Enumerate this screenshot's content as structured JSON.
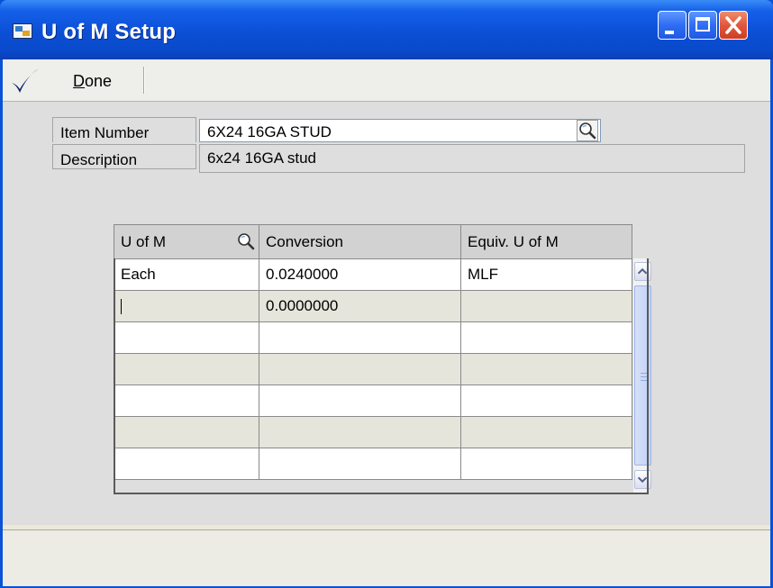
{
  "window": {
    "title": "U of M Setup",
    "icon": "app-window-icon",
    "controls": [
      "minimize-icon",
      "maximize-icon",
      "close-icon"
    ]
  },
  "toolbar": {
    "done_label_prefix": "D",
    "done_label_rest": "one",
    "done_icon": "checkmark-icon"
  },
  "form": {
    "item_number_label": "Item Number",
    "item_number_value": "6X24 16GA STUD",
    "description_label": "Description",
    "description_value": "6x24 16GA stud"
  },
  "grid": {
    "headers": [
      "U of M",
      "Conversion",
      "Equiv. U of M"
    ],
    "rows": [
      [
        "Each",
        "0.0240000",
        "MLF"
      ],
      [
        "",
        "0.0000000",
        ""
      ],
      [
        "",
        "",
        ""
      ],
      [
        "",
        "",
        ""
      ],
      [
        "",
        "",
        ""
      ],
      [
        "",
        "",
        ""
      ],
      [
        "",
        "",
        ""
      ]
    ],
    "scrollbar": "vertical"
  },
  "colors": {
    "titlebar": "#0a4acb",
    "close_button": "#e2573c",
    "window_body": "#dedede"
  }
}
